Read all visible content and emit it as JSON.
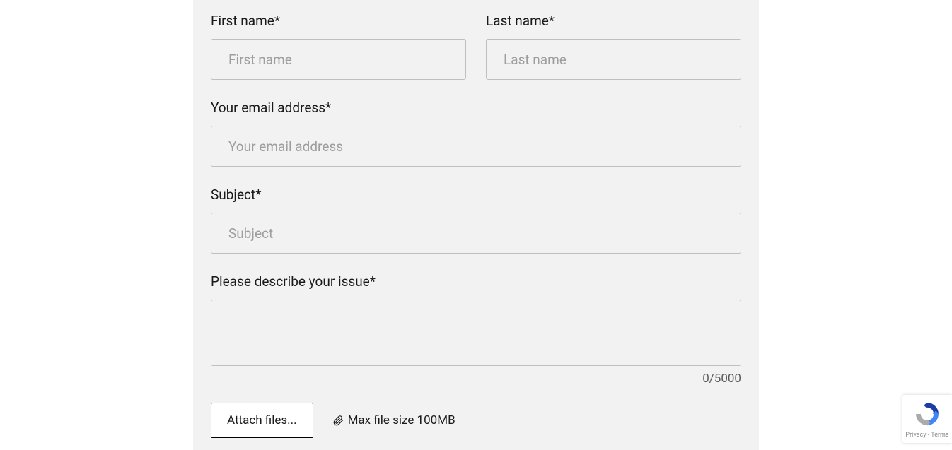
{
  "form": {
    "first_name": {
      "label": "First name*",
      "placeholder": "First name",
      "value": ""
    },
    "last_name": {
      "label": "Last name*",
      "placeholder": "Last name",
      "value": ""
    },
    "email": {
      "label": "Your email address*",
      "placeholder": "Your email address",
      "value": ""
    },
    "subject": {
      "label": "Subject*",
      "placeholder": "Subject",
      "value": ""
    },
    "description": {
      "label": "Please describe your issue*",
      "value": ""
    },
    "char_counter": "0/5000",
    "attach": {
      "button_label": "Attach files...",
      "info": "Max file size 100MB"
    }
  },
  "recaptcha": {
    "privacy": "Privacy",
    "separator": " - ",
    "terms": "Terms"
  }
}
